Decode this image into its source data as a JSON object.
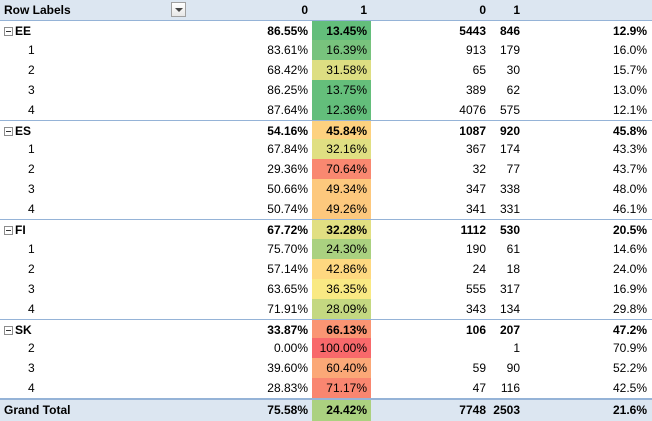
{
  "header": {
    "row_labels": "Row Labels",
    "col1": "0",
    "col2": "1",
    "col3": "0",
    "col4": "1",
    "col5": ""
  },
  "rows": [
    {
      "type": "group",
      "label": "EE",
      "v1": "86.55%",
      "v2": "13.45%",
      "color": "#63be7b",
      "v3": "5443",
      "v4": "846",
      "v5": "12.9%"
    },
    {
      "type": "sub",
      "label": "1",
      "v1": "83.61%",
      "v2": "16.39%",
      "color": "#78c37d",
      "v3": "913",
      "v4": "179",
      "v5": "16.0%"
    },
    {
      "type": "sub",
      "label": "2",
      "v1": "68.42%",
      "v2": "31.58%",
      "color": "#ddde82",
      "v3": "65",
      "v4": "30",
      "v5": "15.7%"
    },
    {
      "type": "sub",
      "label": "3",
      "v1": "86.25%",
      "v2": "13.75%",
      "color": "#65bf7b",
      "v3": "389",
      "v4": "62",
      "v5": "13.0%"
    },
    {
      "type": "sub",
      "label": "4",
      "v1": "87.64%",
      "v2": "12.36%",
      "color": "#63be7b",
      "v3": "4076",
      "v4": "575",
      "v5": "12.1%"
    },
    {
      "type": "group",
      "label": "ES",
      "v1": "54.16%",
      "v2": "45.84%",
      "color": "#fdd17f",
      "v3": "1087",
      "v4": "920",
      "v5": "45.8%"
    },
    {
      "type": "sub",
      "label": "1",
      "v1": "67.84%",
      "v2": "32.16%",
      "color": "#e0df82",
      "v3": "367",
      "v4": "174",
      "v5": "43.3%"
    },
    {
      "type": "sub",
      "label": "2",
      "v1": "29.36%",
      "v2": "70.64%",
      "color": "#f98870",
      "v3": "32",
      "v4": "77",
      "v5": "43.7%"
    },
    {
      "type": "sub",
      "label": "3",
      "v1": "50.66%",
      "v2": "49.34%",
      "color": "#fdc87d",
      "v3": "347",
      "v4": "338",
      "v5": "48.0%"
    },
    {
      "type": "sub",
      "label": "4",
      "v1": "50.74%",
      "v2": "49.26%",
      "color": "#fdc87d",
      "v3": "341",
      "v4": "331",
      "v5": "46.1%"
    },
    {
      "type": "group",
      "label": "FI",
      "v1": "67.72%",
      "v2": "32.28%",
      "color": "#e1df82",
      "v3": "1112",
      "v4": "530",
      "v5": "20.5%"
    },
    {
      "type": "sub",
      "label": "1",
      "v1": "75.70%",
      "v2": "24.30%",
      "color": "#aad180",
      "v3": "190",
      "v4": "61",
      "v5": "14.6%"
    },
    {
      "type": "sub",
      "label": "2",
      "v1": "57.14%",
      "v2": "42.86%",
      "color": "#fed880",
      "v3": "24",
      "v4": "18",
      "v5": "24.0%"
    },
    {
      "type": "sub",
      "label": "3",
      "v1": "63.65%",
      "v2": "36.35%",
      "color": "#f9e983",
      "v3": "555",
      "v4": "317",
      "v5": "16.9%"
    },
    {
      "type": "sub",
      "label": "4",
      "v1": "71.91%",
      "v2": "28.09%",
      "color": "#c4d881",
      "v3": "343",
      "v4": "134",
      "v5": "29.8%"
    },
    {
      "type": "group",
      "label": "SK",
      "v1": "33.87%",
      "v2": "66.13%",
      "color": "#fa9573",
      "v3": "106",
      "v4": "207",
      "v5": "47.2%"
    },
    {
      "type": "sub",
      "label": "2",
      "v1": "0.00%",
      "v2": "100.00%",
      "color": "#f8696b",
      "v3": "",
      "v4": "1",
      "v5": "70.9%"
    },
    {
      "type": "sub",
      "label": "3",
      "v1": "39.60%",
      "v2": "60.40%",
      "color": "#fba877",
      "v3": "59",
      "v4": "90",
      "v5": "52.2%"
    },
    {
      "type": "sub",
      "label": "4",
      "v1": "28.83%",
      "v2": "71.17%",
      "color": "#f98670",
      "v3": "47",
      "v4": "116",
      "v5": "42.5%"
    }
  ],
  "total": {
    "label": "Grand Total",
    "v1": "75.58%",
    "v2": "24.42%",
    "color": "#abd180",
    "v3": "7748",
    "v4": "2503",
    "v5": "21.6%"
  }
}
